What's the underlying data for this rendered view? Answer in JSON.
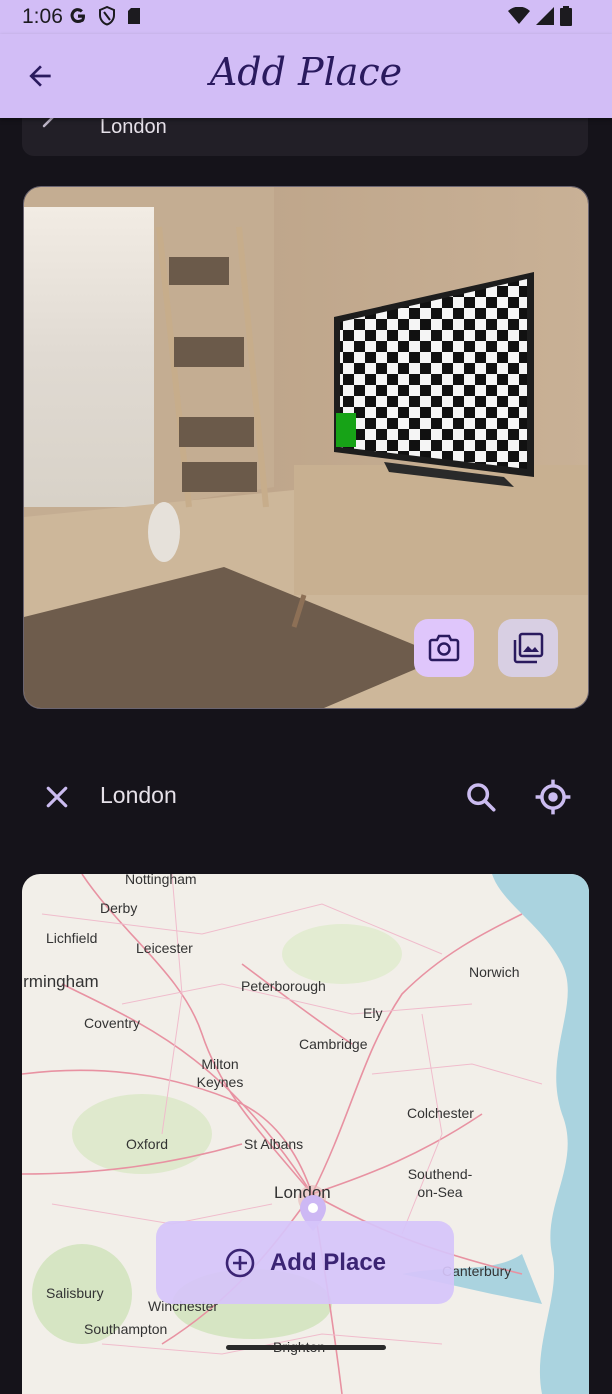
{
  "status_bar": {
    "time": "1:06",
    "icons": [
      "google-icon",
      "shield-icon",
      "sd-card-icon",
      "wifi-icon",
      "signal-icon",
      "battery-icon"
    ]
  },
  "app_bar": {
    "title": "Add Place",
    "back_icon": "arrow-back-icon"
  },
  "title_field": {
    "value": "London"
  },
  "image_picker": {
    "camera_icon": "camera-icon",
    "gallery_icon": "gallery-icon"
  },
  "location_search": {
    "value": "London",
    "placeholder": "",
    "clear_icon": "close-icon",
    "search_icon": "search-icon",
    "current_location_icon": "my-location-icon"
  },
  "map": {
    "labels": [
      "Nottingham",
      "Derby",
      "Lichfield",
      "Leicester",
      "Birmingham",
      "Coventry",
      "Peterborough",
      "Ely",
      "Norwich",
      "Cambridge",
      "Milton Keynes",
      "Colchester",
      "Oxford",
      "St Albans",
      "London",
      "Southend-on-Sea",
      "Canterbury",
      "Salisbury",
      "Winchester",
      "Southampton",
      "Brighton"
    ]
  },
  "add_button": {
    "label": "Add Place",
    "icon": "add-circle-icon"
  },
  "colors": {
    "app_bar": "#d2bdf6",
    "background": "#15131a",
    "accent": "#3b2474"
  }
}
